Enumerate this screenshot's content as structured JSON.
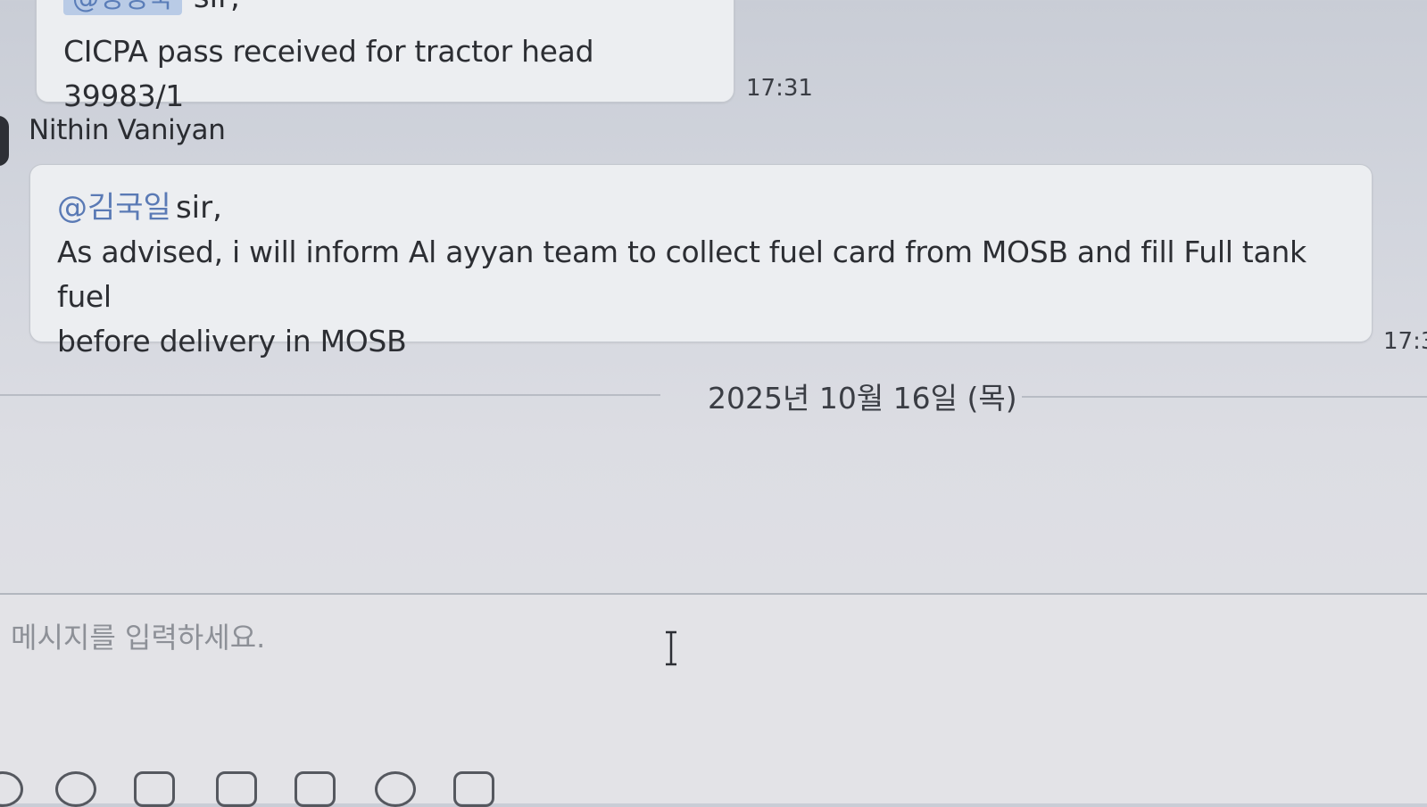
{
  "messages": [
    {
      "mention": "@정정욱",
      "salutation": "sir,",
      "text": "CICPA pass received for tractor head 39983/1",
      "time": "17:31"
    },
    {
      "sender": "Nithin Vaniyan",
      "mention": "@김국일",
      "salutation": "sir,",
      "text_line1": "As advised, i will inform Al ayyan team to collect fuel card from MOSB and fill Full tank fuel",
      "text_line2": "before delivery in MOSB",
      "time": "17:3"
    }
  ],
  "date_divider": "2025년 10월 16일 (목)",
  "composer": {
    "placeholder": "메시지를 입력하세요."
  },
  "toolbar": {
    "icons": [
      "attach-icon",
      "emoji-icon",
      "font-icon",
      "edit-icon",
      "keyboard-icon",
      "capture-icon",
      "image-icon"
    ]
  },
  "colors": {
    "mention": "#5a7ab5",
    "bubble": "#eceef1",
    "background": "#d3d6de"
  }
}
